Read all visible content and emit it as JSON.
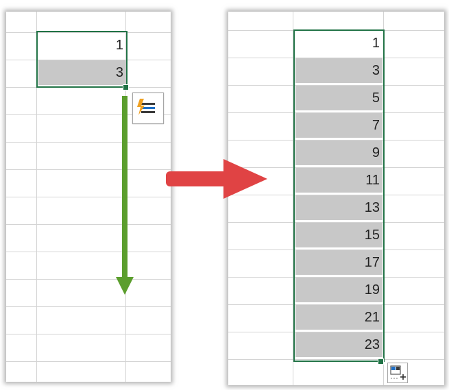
{
  "left": {
    "cells": [
      "1",
      "3"
    ]
  },
  "right": {
    "cells": [
      "1",
      "3",
      "5",
      "7",
      "9",
      "11",
      "13",
      "15",
      "17",
      "19",
      "21",
      "23"
    ]
  },
  "icons": {
    "flash_fill": "flash-fill-icon",
    "autofill_options": "autofill-options-icon"
  },
  "colors": {
    "selection_border": "#217346",
    "selection_fill": "#c8c8c8",
    "drag_arrow": "#5b9e2d",
    "transform_arrow": "#e04344"
  }
}
